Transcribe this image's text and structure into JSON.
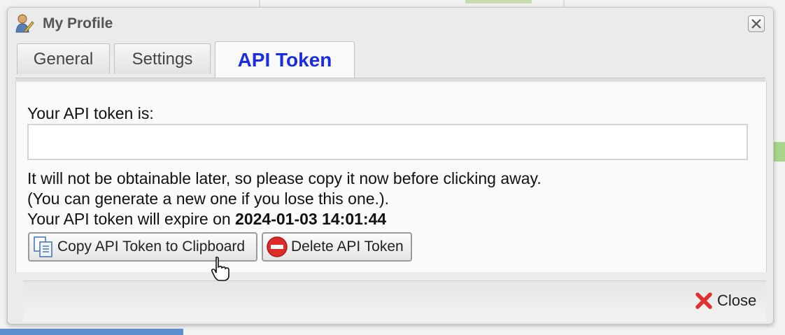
{
  "dialog": {
    "title": "My Profile",
    "tabs": [
      {
        "label": "General",
        "active": false
      },
      {
        "label": "Settings",
        "active": false
      },
      {
        "label": "API Token",
        "active": true
      }
    ]
  },
  "api_token": {
    "label": "Your API token is:",
    "value": "",
    "notice_line1": "It will not be obtainable later, so please copy it now before clicking away.",
    "notice_line2": "(You can generate a new one if you lose this one.).",
    "expire_prefix": "Your API token will expire on",
    "expire_date": "2024-01-03 14:01:44"
  },
  "buttons": {
    "copy_label": "Copy API Token to Clipboard",
    "delete_label": "Delete API Token",
    "close_label": "Close"
  },
  "icons": {
    "title": "user-edit-icon",
    "copy": "copy-icon",
    "delete": "delete-icon",
    "close": "close-icon"
  },
  "colors": {
    "active_tab_text": "#1a2ce6",
    "delete_icon": "#e02b2b",
    "close_icon": "#e03030"
  }
}
